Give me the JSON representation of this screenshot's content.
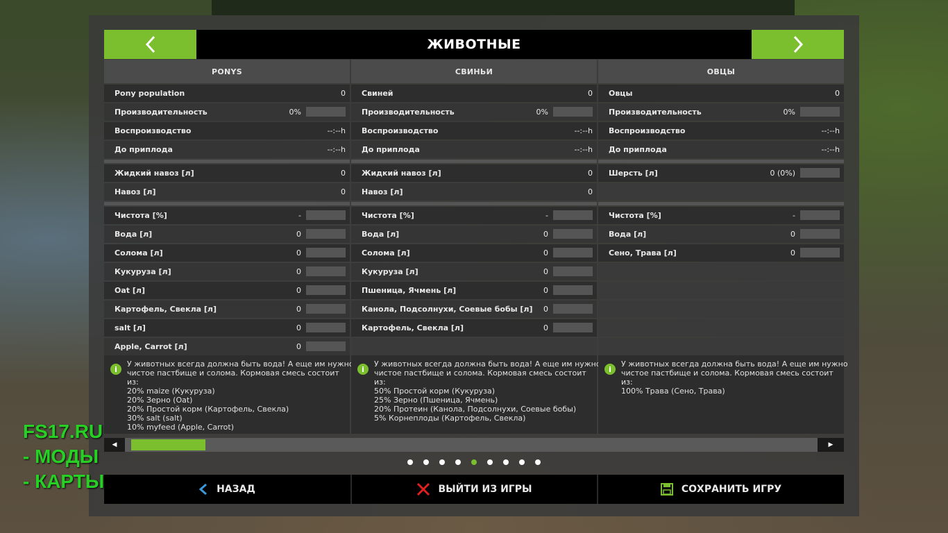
{
  "header": {
    "title": "ЖИВОТНЫЕ",
    "prev_icon": "chevron-left-icon",
    "next_icon": "chevron-right-icon"
  },
  "columns": [
    {
      "title": "PONYS",
      "stats": [
        {
          "label": "Pony population",
          "value": "0"
        },
        {
          "label": "Производительность",
          "value": "0%"
        },
        {
          "label": "Воспроизводство",
          "value": "--:--h"
        },
        {
          "label": "До приплода",
          "value": "--:--h"
        }
      ],
      "production": [
        {
          "label": "Жидкий навоз [л]",
          "value": "0"
        },
        {
          "label": "Навоз [л]",
          "value": "0"
        }
      ],
      "needs": [
        {
          "label": "Чистота [%]",
          "value": "-"
        },
        {
          "label": "Вода [л]",
          "value": "0"
        },
        {
          "label": "Солома [л]",
          "value": "0"
        },
        {
          "label": "Кукуруза [л]",
          "value": "0"
        },
        {
          "label": "Oat [л]",
          "value": "0"
        },
        {
          "label": "Картофель, Свекла [л]",
          "value": "0"
        },
        {
          "label": "salt [л]",
          "value": "0"
        },
        {
          "label": "Apple, Carrot [л]",
          "value": "0"
        }
      ],
      "info": [
        "У животных всегда должна быть вода! А еще им нужно",
        "чистое пастбище и солома. Кормовая смесь состоит",
        "из:",
        "20% maize (Кукуруза)",
        "20% Зерно (Oat)",
        "20% Простой корм (Картофель, Свекла)",
        "30% salt (salt)",
        "10% myfeed (Apple, Carrot)"
      ]
    },
    {
      "title": "СВИНЬИ",
      "stats": [
        {
          "label": "Свиней",
          "value": "0"
        },
        {
          "label": "Производительность",
          "value": "0%"
        },
        {
          "label": "Воспроизводство",
          "value": "--:--h"
        },
        {
          "label": "До приплода",
          "value": "--:--h"
        }
      ],
      "production": [
        {
          "label": "Жидкий навоз [л]",
          "value": "0"
        },
        {
          "label": "Навоз [л]",
          "value": "0"
        }
      ],
      "needs": [
        {
          "label": "Чистота [%]",
          "value": "-"
        },
        {
          "label": "Вода [л]",
          "value": "0"
        },
        {
          "label": "Солома [л]",
          "value": "0"
        },
        {
          "label": "Кукуруза [л]",
          "value": "0"
        },
        {
          "label": "Пшеница, Ячмень [л]",
          "value": "0"
        },
        {
          "label": "Канола, Подсолнухи, Соевые бобы [л]",
          "value": "0"
        },
        {
          "label": "Картофель, Свекла [л]",
          "value": "0"
        }
      ],
      "info": [
        "У животных всегда должна быть вода! А еще им нужно",
        "чистое пастбище и солома. Кормовая смесь состоит",
        "из:",
        "50% Простой корм (Кукуруза)",
        "25% Зерно (Пшеница, Ячмень)",
        "20% Протеин (Канола, Подсолнухи, Соевые бобы)",
        "5% Корнеплоды (Картофель, Свекла)"
      ]
    },
    {
      "title": "ОВЦЫ",
      "stats": [
        {
          "label": "Овцы",
          "value": "0"
        },
        {
          "label": "Производительность",
          "value": "0%"
        },
        {
          "label": "Воспроизводство",
          "value": "--:--h"
        },
        {
          "label": "До приплода",
          "value": "--:--h"
        }
      ],
      "production": [
        {
          "label": "Шерсть [л]",
          "value": "0 (0%)"
        }
      ],
      "needs": [
        {
          "label": "Чистота [%]",
          "value": "-"
        },
        {
          "label": "Вода [л]",
          "value": "0"
        },
        {
          "label": "Сено, Трава [л]",
          "value": "0"
        }
      ],
      "info": [
        "У животных всегда должна быть вода! А еще им нужно",
        "чистое пастбище и солома. Кормовая смесь состоит",
        "из:",
        "100% Трава (Сено, Трава)"
      ]
    }
  ],
  "pager": {
    "count": 9,
    "active": 4
  },
  "scrollbar": {
    "position": 0.1
  },
  "footer": {
    "back_label": "НАЗАД",
    "quit_label": "ВЫЙТИ ИЗ ИГРЫ",
    "save_label": "СОХРАНИТЬ ИГРУ",
    "accent": "#7cbf2e",
    "quit_color": "#e02020",
    "back_color": "#3a9ad9"
  },
  "watermark": [
    "FS17.RU",
    " - МОДЫ",
    " - КАРТЫ"
  ]
}
